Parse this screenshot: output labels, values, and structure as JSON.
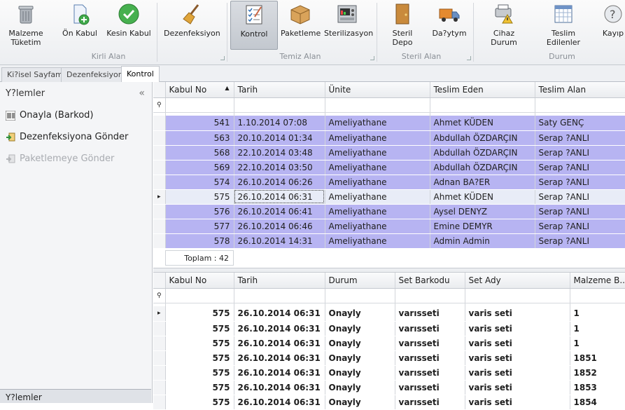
{
  "ribbon": {
    "buttons": [
      {
        "id": "malzeme",
        "label": "Malzeme\nTüketim",
        "icon": "trash-can-icon"
      },
      {
        "id": "onkabul",
        "label": "Ön Kabul",
        "icon": "add-document-icon"
      },
      {
        "id": "kesinkabul",
        "label": "Kesin Kabul",
        "icon": "check-circle-icon"
      },
      {
        "id": "dezenf",
        "label": "Dezenfeksiyon",
        "icon": "broom-icon"
      },
      {
        "id": "kontrol",
        "label": "Kontrol",
        "icon": "checklist-icon"
      },
      {
        "id": "paketleme",
        "label": "Paketleme",
        "icon": "box-icon"
      },
      {
        "id": "steril",
        "label": "Sterilizasyon",
        "icon": "machine-icon"
      },
      {
        "id": "sterildepo",
        "label": "Steril Depo",
        "icon": "door-icon"
      },
      {
        "id": "dagitim",
        "label": "Da?ytym",
        "icon": "truck-icon"
      },
      {
        "id": "cihaz",
        "label": "Cihaz Durum",
        "icon": "warning-printer-icon"
      },
      {
        "id": "teslim",
        "label": "Teslim Edilenler",
        "icon": "calendar-grid-icon"
      },
      {
        "id": "kayip",
        "label": "Kayıp",
        "icon": "lost-icon"
      }
    ],
    "groups": [
      "Kirli Alan",
      "Temiz Alan",
      "Steril Alan",
      "Durum"
    ]
  },
  "tabs": [
    "Ki?isel Sayfam",
    "Dezenfeksiyon",
    "Kontrol"
  ],
  "sidebar": {
    "title": "Y?lemler",
    "collapse": "«",
    "items": [
      {
        "label": "Onayla (Barkod)",
        "icon": "barcode-icon",
        "enabled": true
      },
      {
        "label": "Dezenfeksiyona Gönder",
        "icon": "send-disinfect-icon",
        "enabled": true
      },
      {
        "label": "Paketlemeye Gönder",
        "icon": "send-package-icon",
        "enabled": false
      }
    ],
    "footer": "Y?lemler"
  },
  "grid1": {
    "columns": [
      "Kabul No",
      "Tarih",
      "Ünite",
      "Teslim Eden",
      "Teslim Alan"
    ],
    "sort_indicator": "▲",
    "rows": [
      [
        "541",
        "1.10.2014 07:08",
        "Ameliyathane",
        "Ahmet KÜDEN",
        "Saty GENÇ"
      ],
      [
        "563",
        "20.10.2014 01:34",
        "Ameliyathane",
        "Abdullah ÖZDARÇIN",
        "Serap ?ANLI"
      ],
      [
        "568",
        "22.10.2014 03:48",
        "Ameliyathane",
        "Abdullah ÖZDARÇIN",
        "Serap ?ANLI"
      ],
      [
        "569",
        "22.10.2014 03:50",
        "Ameliyathane",
        "Abdullah ÖZDARÇIN",
        "Serap ?ANLI"
      ],
      [
        "574",
        "26.10.2014 06:26",
        "Ameliyathane",
        "Adnan BA?ER",
        "Serap ?ANLI"
      ],
      [
        "575",
        "26.10.2014 06:31",
        "Ameliyathane",
        "Ahmet KÜDEN",
        "Serap ?ANLI"
      ],
      [
        "576",
        "26.10.2014 06:41",
        "Ameliyathane",
        "Aysel DENYZ",
        "Serap ?ANLI"
      ],
      [
        "577",
        "26.10.2014 06:46",
        "Ameliyathane",
        "Emine DEMYR",
        "Serap ?ANLI"
      ],
      [
        "578",
        "26.10.2014 14:31",
        "Ameliyathane",
        "Admin Admin",
        "Serap ?ANLI"
      ]
    ],
    "current_row_index": 5,
    "total": "Toplam : 42",
    "highlight_color": "#b7b4f2"
  },
  "grid2": {
    "columns": [
      "Kabul No",
      "Tarih",
      "Durum",
      "Set Barkodu",
      "Set Ady",
      "Malzeme B..."
    ],
    "rows": [
      [
        "575",
        "26.10.2014 06:31",
        "Onayly",
        "varısseti",
        "varis seti",
        "1"
      ],
      [
        "575",
        "26.10.2014 06:31",
        "Onayly",
        "varısseti",
        "varis seti",
        "1"
      ],
      [
        "575",
        "26.10.2014 06:31",
        "Onayly",
        "varısseti",
        "varis seti",
        "1"
      ],
      [
        "575",
        "26.10.2014 06:31",
        "Onayly",
        "varısseti",
        "varis seti",
        "1851"
      ],
      [
        "575",
        "26.10.2014 06:31",
        "Onayly",
        "varısseti",
        "varis seti",
        "1852"
      ],
      [
        "575",
        "26.10.2014 06:31",
        "Onayly",
        "varısseti",
        "varis seti",
        "1853"
      ],
      [
        "575",
        "26.10.2014 06:31",
        "Onayly",
        "varısseti",
        "varis seti",
        "1854"
      ]
    ]
  }
}
